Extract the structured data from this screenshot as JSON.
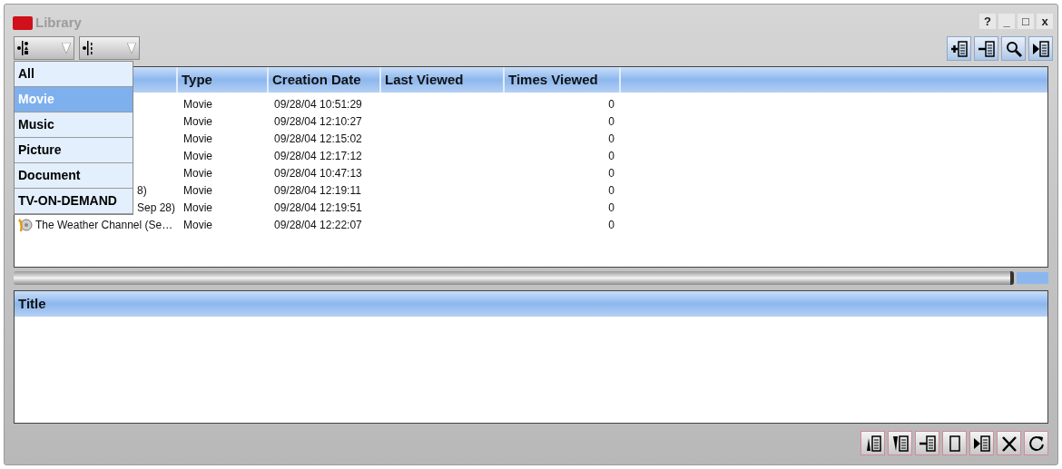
{
  "window": {
    "title": "Library",
    "controls": [
      "?",
      "_",
      "□",
      "x"
    ]
  },
  "filter_dropdowns": [
    {
      "kind": "shapes"
    },
    {
      "kind": "numbers"
    }
  ],
  "filter_menu": {
    "items": [
      {
        "label": "All",
        "selected": false
      },
      {
        "label": "Movie",
        "selected": true
      },
      {
        "label": "Music",
        "selected": false
      },
      {
        "label": "Picture",
        "selected": false
      },
      {
        "label": "Document",
        "selected": false
      },
      {
        "label": "TV-ON-DEMAND",
        "selected": false
      }
    ]
  },
  "top_toolbar": [
    {
      "kind": "add"
    },
    {
      "kind": "remove"
    },
    {
      "kind": "search"
    },
    {
      "kind": "play"
    }
  ],
  "library_table": {
    "columns": [
      "Type",
      "Creation Date",
      "Last Viewed",
      "Times Viewed"
    ],
    "rows": [
      {
        "type": "Movie",
        "created": "09/28/04 10:51:29",
        "times_viewed": "0"
      },
      {
        "type": "Movie",
        "created": "09/28/04 12:10:27",
        "times_viewed": "0"
      },
      {
        "type": "Movie",
        "created": "09/28/04 12:15:02",
        "times_viewed": "0"
      },
      {
        "type": "Movie",
        "created": "09/28/04 12:17:12",
        "times_viewed": "0"
      },
      {
        "type": "Movie",
        "created": "09/28/04 10:47:13",
        "times_viewed": "0"
      },
      {
        "title": "8)",
        "kind": "covered",
        "type": "Movie",
        "created": "09/28/04 12:19:11",
        "times_viewed": "0"
      },
      {
        "title": "Sep 28)",
        "kind": "covered",
        "type": "Movie",
        "created": "09/28/04 12:19:51",
        "times_viewed": "0"
      },
      {
        "title": "The Weather Channel (Se…",
        "kind": "full",
        "type": "Movie",
        "created": "09/28/04 12:22:07",
        "times_viewed": "0"
      }
    ]
  },
  "playlist_table": {
    "columns": [
      "Title"
    ]
  },
  "bottom_toolbar": [
    {
      "kind": "sort-up"
    },
    {
      "kind": "sort-down"
    },
    {
      "kind": "remove"
    },
    {
      "kind": "blank"
    },
    {
      "kind": "play"
    },
    {
      "kind": "cut"
    },
    {
      "kind": "refresh"
    }
  ]
}
